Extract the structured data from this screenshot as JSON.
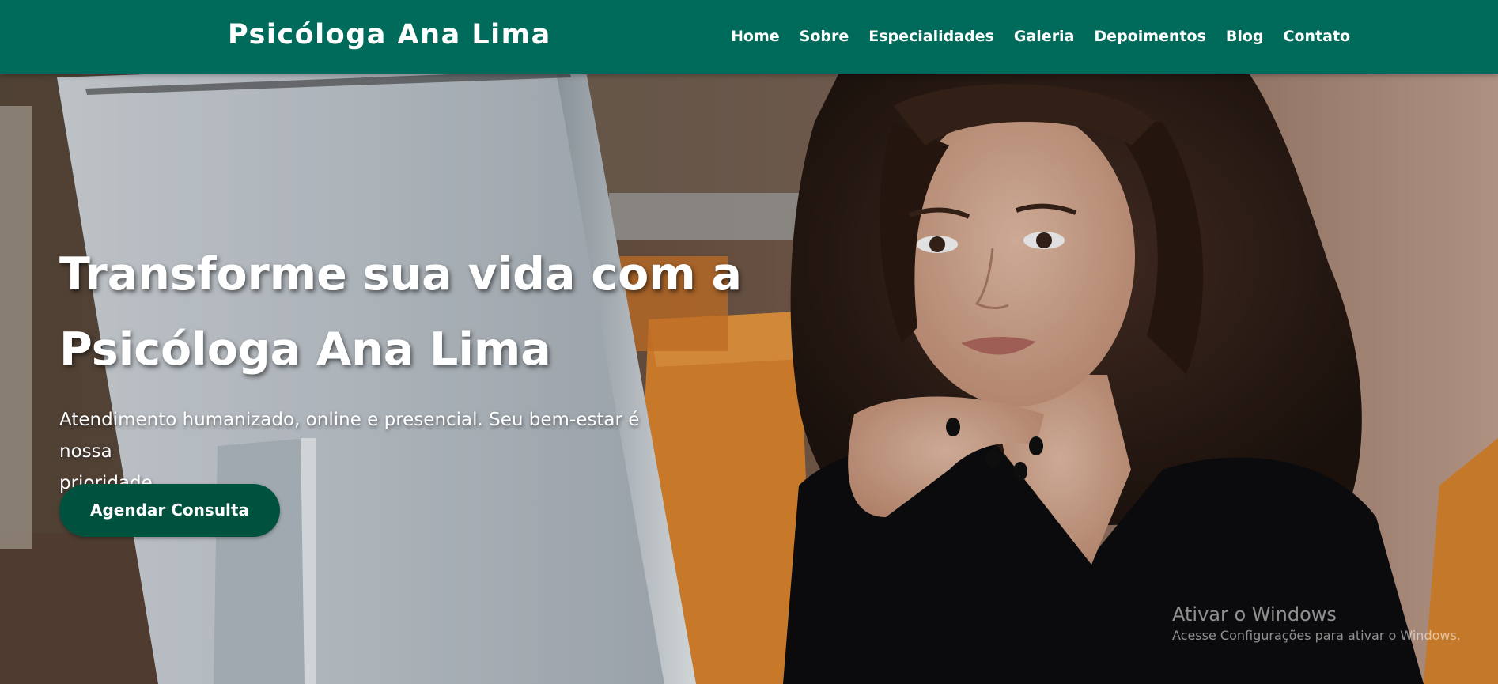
{
  "header": {
    "brand": "Psicóloga Ana Lima",
    "background_color": "#006b5b",
    "nav": [
      {
        "label": "Home"
      },
      {
        "label": "Sobre"
      },
      {
        "label": "Especialidades"
      },
      {
        "label": "Galeria"
      },
      {
        "label": "Depoimentos"
      },
      {
        "label": "Blog"
      },
      {
        "label": "Contato"
      }
    ]
  },
  "hero": {
    "title_line1": "Transforme sua vida com a",
    "title_line2": "Psicóloga Ana Lima",
    "subtitle_line1": "Atendimento humanizado, online e presencial. Seu bem-estar é nossa",
    "subtitle_line2": "prioridade.",
    "cta_label": "Agendar Consulta",
    "cta_color": "#00523f"
  },
  "windows_watermark": {
    "title": "Ativar o Windows",
    "subtitle": "Acesse Configurações para ativar o Windows."
  }
}
